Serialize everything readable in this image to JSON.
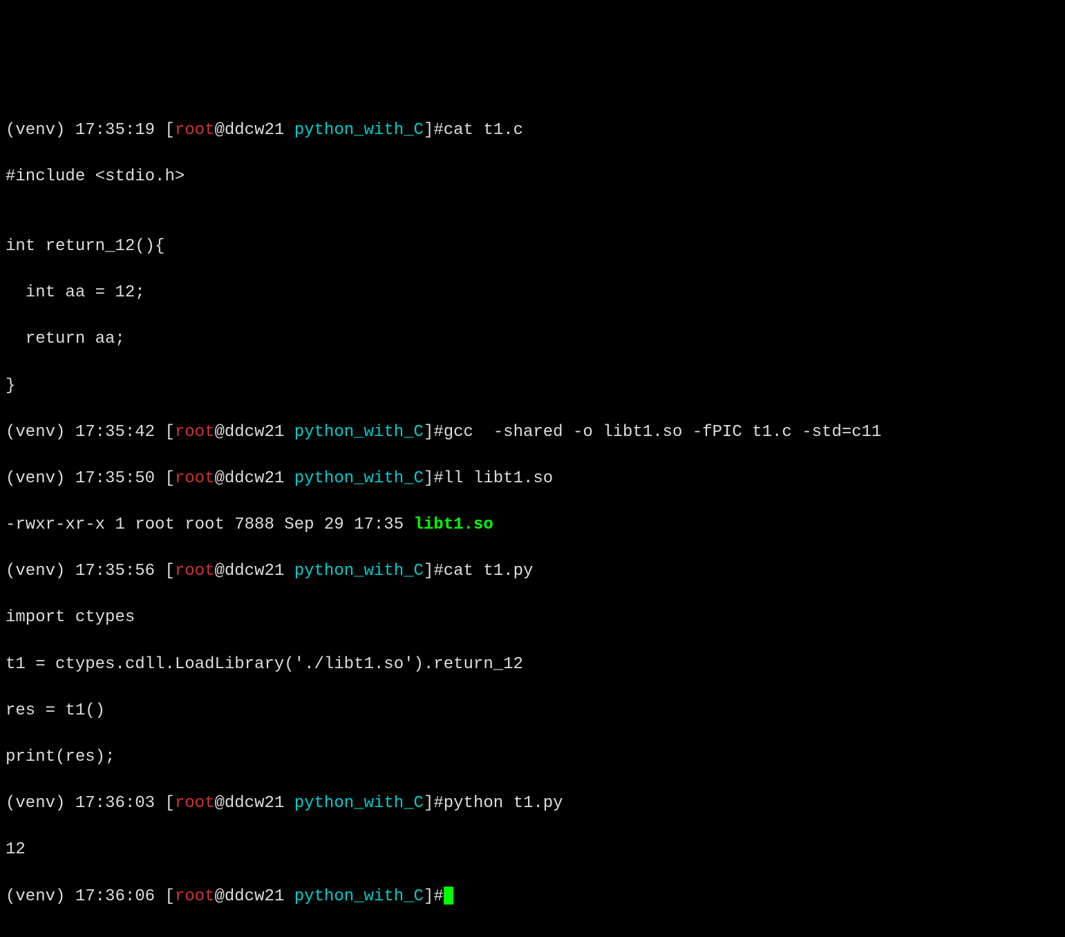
{
  "colors": {
    "user": "#cc3333",
    "host_text": "#dddddd",
    "dir": "#00cccc",
    "file_exec": "#00ff00"
  },
  "prompts": [
    {
      "venv": "(venv)",
      "time": "17:35:19",
      "user": "root",
      "host": "ddcw21",
      "dir": "python_with_C",
      "cmd": "cat t1.c"
    },
    {
      "venv": "(venv)",
      "time": "17:35:42",
      "user": "root",
      "host": "ddcw21",
      "dir": "python_with_C",
      "cmd": "gcc  -shared -o libt1.so -fPIC t1.c -std=c11"
    },
    {
      "venv": "(venv)",
      "time": "17:35:50",
      "user": "root",
      "host": "ddcw21",
      "dir": "python_with_C",
      "cmd": "ll libt1.so "
    },
    {
      "venv": "(venv)",
      "time": "17:35:56",
      "user": "root",
      "host": "ddcw21",
      "dir": "python_with_C",
      "cmd": "cat t1.py"
    },
    {
      "venv": "(venv)",
      "time": "17:36:03",
      "user": "root",
      "host": "ddcw21",
      "dir": "python_with_C",
      "cmd": "python t1.py"
    },
    {
      "venv": "(venv)",
      "time": "17:36:06",
      "user": "root",
      "host": "ddcw21",
      "dir": "python_with_C",
      "cmd": ""
    }
  ],
  "output_cat_c": {
    "l0": "#include <stdio.h>",
    "l1": "",
    "l2": "int return_12(){",
    "l3": "  int aa = 12;",
    "l4": "  return aa;",
    "l5": "}"
  },
  "output_ll": {
    "perm_owner": "-rwxr-xr-x 1 root root 7888 Sep 29 17:35 ",
    "file": "libt1.so"
  },
  "output_cat_py": {
    "l0": "import ctypes",
    "l1": "t1 = ctypes.cdll.LoadLibrary('./libt1.so').return_12",
    "l2": "res = t1()",
    "l3": "print(res);"
  },
  "output_run": "12",
  "watermark": ""
}
